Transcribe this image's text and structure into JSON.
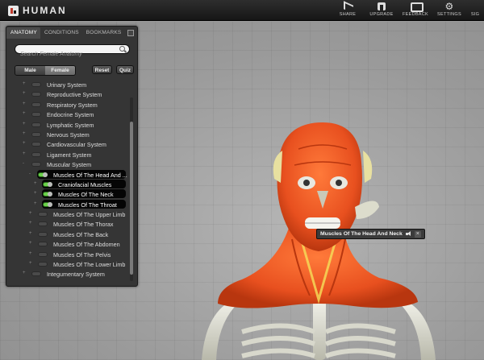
{
  "app": {
    "logo_text": "HUMAN"
  },
  "toolbar": {
    "share": "SHARE",
    "upgrade": "UPGRADE",
    "feedback": "FEEDBACK",
    "settings": "SETTINGS",
    "cut_off": "SIG"
  },
  "panel": {
    "tabs": [
      "ANATOMY",
      "CONDITIONS",
      "BOOKMARKS"
    ],
    "search_placeholder": "Search Female Anatomy",
    "buttons": {
      "male": "Male",
      "female": "Female",
      "reset": "Reset",
      "quiz": "Quiz"
    },
    "tree": [
      {
        "label": "Urinary System",
        "level": 0,
        "expander": "+",
        "toggle": "off",
        "highlight": false
      },
      {
        "label": "Reproductive System",
        "level": 0,
        "expander": "+",
        "toggle": "off",
        "highlight": false
      },
      {
        "label": "Respiratory System",
        "level": 0,
        "expander": "+",
        "toggle": "off",
        "highlight": false
      },
      {
        "label": "Endocrine System",
        "level": 0,
        "expander": "+",
        "toggle": "off",
        "highlight": false
      },
      {
        "label": "Lymphatic System",
        "level": 0,
        "expander": "+",
        "toggle": "off",
        "highlight": false
      },
      {
        "label": "Nervous System",
        "level": 0,
        "expander": "+",
        "toggle": "off",
        "highlight": false
      },
      {
        "label": "Cardiovascular System",
        "level": 0,
        "expander": "+",
        "toggle": "off",
        "highlight": false
      },
      {
        "label": "Ligament System",
        "level": 0,
        "expander": "+",
        "toggle": "off",
        "highlight": false
      },
      {
        "label": "Muscular System",
        "level": 0,
        "expander": "-",
        "toggle": "off",
        "highlight": false
      },
      {
        "label": "Muscles Of The Head And ...",
        "level": 1,
        "expander": "-",
        "toggle": "on",
        "highlight": true
      },
      {
        "label": "Craniofacial Muscles",
        "level": 2,
        "expander": "+",
        "toggle": "on",
        "highlight": true
      },
      {
        "label": "Muscles Of The Neck",
        "level": 2,
        "expander": "+",
        "toggle": "on",
        "highlight": true
      },
      {
        "label": "Muscles Of The Throat",
        "level": 2,
        "expander": "+",
        "toggle": "on",
        "highlight": true
      },
      {
        "label": "Muscles Of The Upper Limb",
        "level": 1,
        "expander": "+",
        "toggle": "off",
        "highlight": false
      },
      {
        "label": "Muscles Of The Thorax",
        "level": 1,
        "expander": "+",
        "toggle": "off",
        "highlight": false
      },
      {
        "label": "Muscles Of The Back",
        "level": 1,
        "expander": "+",
        "toggle": "off",
        "highlight": false
      },
      {
        "label": "Muscles Of The Abdomen",
        "level": 1,
        "expander": "+",
        "toggle": "off",
        "highlight": false
      },
      {
        "label": "Muscles Of The Pelvis",
        "level": 1,
        "expander": "+",
        "toggle": "off",
        "highlight": false
      },
      {
        "label": "Muscles Of The Lower Limb",
        "level": 1,
        "expander": "+",
        "toggle": "off",
        "highlight": false
      },
      {
        "label": "Integumentary System",
        "level": 0,
        "expander": "+",
        "toggle": "off",
        "highlight": false
      }
    ]
  },
  "model_label": {
    "text": "Muscles Of The Head And Neck"
  },
  "colors": {
    "muscle": "#e8501f",
    "bone": "#dcdcd0",
    "background": "#9a9a9a",
    "toggle_on": "#6ad14a"
  }
}
